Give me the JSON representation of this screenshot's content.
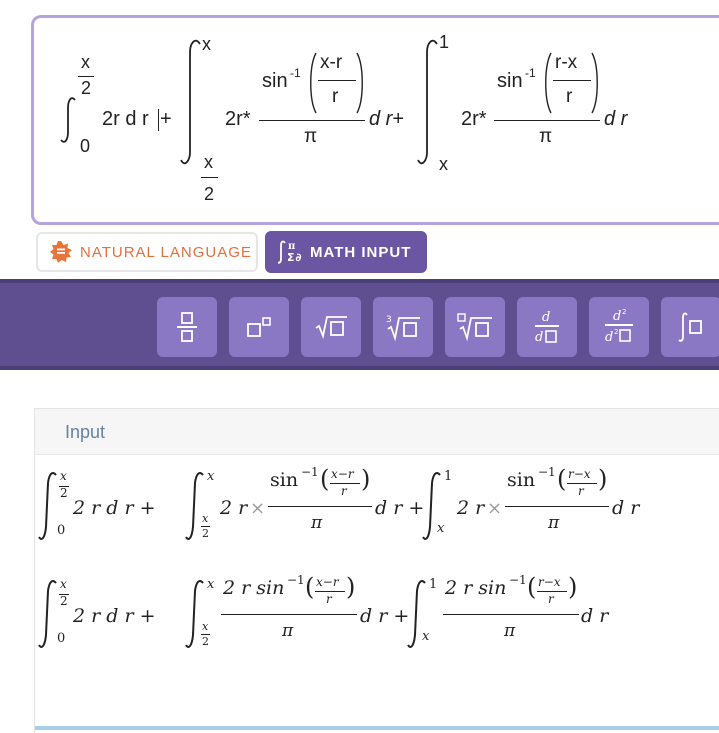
{
  "editor": {
    "expr": {
      "int1_upper_num": "x",
      "int1_upper_den": "2",
      "int1_lower": "0",
      "int1_body": "2r d r",
      "plus": "+",
      "int2_upper": "x",
      "int2_lower_num": "x",
      "int2_lower_den": "2",
      "coef": "2r*",
      "sin": "sin",
      "inv": "-1",
      "frac2_num": "x-r",
      "frac2_den": "r",
      "pi": "π",
      "dr": "d r",
      "int3_upper": "1",
      "int3_lower": "x",
      "frac3_num": "r-x",
      "frac3_den": "r"
    }
  },
  "modes": {
    "natural_language": "NATURAL LANGUAGE",
    "math_input": "MATH INPUT",
    "natural_language_icon": "calculator-badge-icon",
    "math_input_icon": "integral-sigma-icon"
  },
  "toolbar": {
    "buttons": [
      {
        "name": "fraction-icon"
      },
      {
        "name": "exponent-icon"
      },
      {
        "name": "sqrt-icon"
      },
      {
        "name": "cube-root-icon"
      },
      {
        "name": "nth-root-icon"
      },
      {
        "name": "derivative-icon"
      },
      {
        "name": "second-derivative-icon"
      },
      {
        "name": "integral-icon"
      }
    ]
  },
  "output": {
    "title": "Input",
    "line1": {
      "int1_upper_num": "x",
      "int1_upper_den": "2",
      "int1_lower": "0",
      "term1": "2 r d r +",
      "int2_upper": "x",
      "int2_lower_num": "x",
      "int2_lower_den": "2",
      "coef": "2 r",
      "times": "×",
      "sin_inv": "sin",
      "sup": "−1",
      "frac2_inner_num": "x−r",
      "frac2_inner_den": "r",
      "pi": "π",
      "dr_plus": "d r +",
      "int3_upper": "1",
      "int3_lower": "x",
      "frac3_inner_num": "r−x",
      "frac3_inner_den": "r",
      "dr": "d r"
    },
    "line2": {
      "term1": "2 r d r +",
      "num2": "2 r sin",
      "num3": "2 r sin",
      "pi": "π",
      "dr_plus": "d r +",
      "dr": "d r"
    }
  },
  "colors": {
    "accent": "#6a56a2",
    "toolbar_bg": "#5f4f91",
    "toolbar_btn": "#8a78c4",
    "input_border": "#b5a3dd",
    "natural_language": "#e0703c",
    "panel_title": "#6583a3"
  }
}
